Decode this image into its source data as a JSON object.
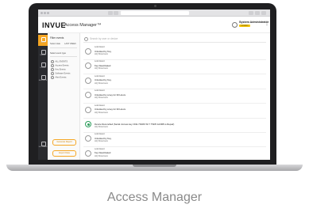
{
  "app": {
    "brand": "INVUE",
    "title": "Access Manager™",
    "user_name": "System Administrator",
    "user_role": "Location"
  },
  "caption": "Access Manager",
  "rail": [
    "DASH",
    "USERS",
    "LOCKS",
    "REPORTS",
    "SETTINGS"
  ],
  "filters": {
    "heading": "Filter events",
    "tabs": [
      "Select date",
      "LAST WEEK"
    ],
    "group_label": "Select event type",
    "options": [
      "ALL EVENTS",
      "Access Events",
      "Key Events",
      "Software Events",
      "Alert Events"
    ],
    "buttons": [
      "Generate Report",
      "Export Data"
    ]
  },
  "search": {
    "placeholder": "Search by user or device"
  },
  "events": [
    {
      "type": "Lock Event",
      "title": "Unlocked by Key",
      "location": "HQ Showroom",
      "ok": false
    },
    {
      "type": "Lock Event",
      "title": "Key Deactivated",
      "location": "HQ Showroom",
      "ok": false
    },
    {
      "type": "Lock Event",
      "title": "Unlocked by Key",
      "location": "HQ Showroom",
      "ok": false
    },
    {
      "type": "Lock Event",
      "title": "Unlocked by a key for 30 Hours",
      "location": "HQ Showroom",
      "ok": false
    },
    {
      "type": "Lock Event",
      "title": "Unlocked by a key for 30 Hours",
      "location": "HQ Showroom",
      "ok": false
    },
    {
      "type": "",
      "title": "Device Reconciled (Serial: Access key OCE 7D18F WI 7 TSD5 1A3R8 to Repair)",
      "location": "HQ Showroom",
      "ok": true
    },
    {
      "type": "Lock Event",
      "title": "Unlocked by Key",
      "location": "HQ Showroom",
      "ok": false
    },
    {
      "type": "Lock Event",
      "title": "Key Deactivated",
      "location": "HQ Showroom",
      "ok": false
    }
  ]
}
